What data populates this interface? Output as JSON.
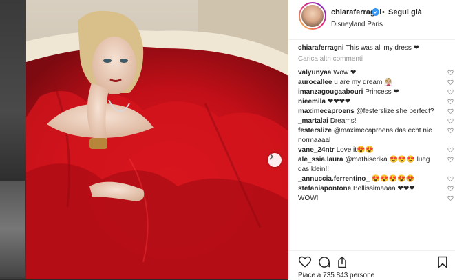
{
  "header": {
    "username": "chiaraferragni",
    "separator": "•",
    "follow_label": "Segui già",
    "location": "Disneyland Paris"
  },
  "caption": {
    "username": "chiaraferragni",
    "text": "This was all my dress ❤"
  },
  "load_more_label": "Carica altri commenti",
  "comments": [
    {
      "username": "valyunyaa",
      "text": "Wow ❤"
    },
    {
      "username": "aurocallee",
      "text": "u are my dream 👰🏼"
    },
    {
      "username": "imanzagougaabouri",
      "text": "Princess ❤"
    },
    {
      "username": "nieemila",
      "text": "❤❤❤❤"
    },
    {
      "username": "maximecaproens",
      "text": "@festerslize she perfect?"
    },
    {
      "username": "_martalai",
      "text": "Dreams!"
    },
    {
      "username": "festerslize",
      "text": "@maximecaproens das echt nie normaaaal"
    },
    {
      "username": "vane_24ntr",
      "text": "Love it😍😍"
    },
    {
      "username": "ale_ssia.laura",
      "text": "@mathiserika 😍😍😍 lueg das klein!!"
    },
    {
      "username": "_annuccia.ferrentino_",
      "text": "😍😍😍😍😍"
    },
    {
      "username": "stefaniapontone",
      "text": "Bellissimaaaa ❤❤❤"
    },
    {
      "username": "",
      "text": "WOW!"
    }
  ],
  "likes_text": "Piace a 735.843 persone",
  "colors": {
    "accent": "#3897f0",
    "heart": "#e8102b",
    "dress": "#c8101a"
  },
  "icons": [
    "heart-icon",
    "comment-icon",
    "share-icon",
    "bookmark-icon",
    "chevron-right-icon",
    "verified-icon"
  ]
}
